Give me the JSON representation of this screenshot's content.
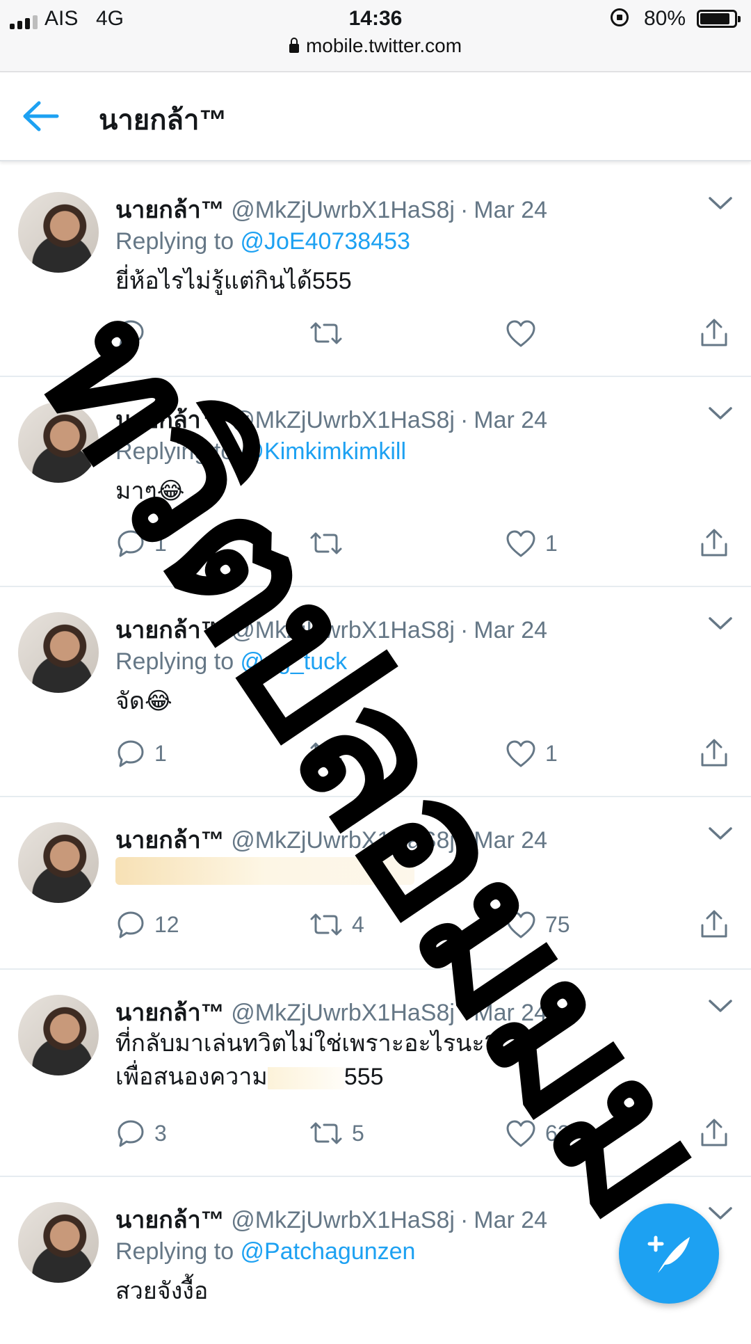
{
  "status_bar": {
    "carrier": "AIS",
    "network": "4G",
    "time": "14:36",
    "battery": "80%",
    "url": "mobile.twitter.com"
  },
  "header": {
    "title": "นายกล้า™"
  },
  "tweets": [
    {
      "name": "นายกล้า™",
      "handle": "@MkZjUwrbX1HaS8j",
      "sep": "·",
      "date": "Mar 24",
      "reply_prefix": "Replying to ",
      "reply_to": "@JoE40738453",
      "text": "ยี่ห้อไรไม่รู้แต่กินได้555",
      "replies": "",
      "retweets": "",
      "likes": ""
    },
    {
      "name": "นายกล้า™",
      "handle": "@MkZjUwrbX1HaS8j",
      "sep": "·",
      "date": "Mar 24",
      "reply_prefix": "Replying to ",
      "reply_to": "@Kimkimkimkill",
      "text": "มาๆ😂",
      "replies": "1",
      "retweets": "",
      "likes": "1"
    },
    {
      "name": "นายกล้า™",
      "handle": "@MkZjUwrbX1HaS8j",
      "sep": "·",
      "date": "Mar 24",
      "reply_prefix": "Replying to ",
      "reply_to": "@pg_tuck",
      "text": "จัด😂",
      "replies": "1",
      "retweets": "",
      "likes": "1"
    },
    {
      "name": "นายกล้า™",
      "handle": "@MkZjUwrbX1HaS8j",
      "sep": "·",
      "date": "Mar 24",
      "text": "",
      "replies": "12",
      "retweets": "4",
      "likes": "75"
    },
    {
      "name": "นายกล้า™",
      "handle": "@MkZjUwrbX1HaS8j",
      "sep": "·",
      "date": "Mar 24",
      "text_line1": "ที่กลับมาเล่นทวิตไม่ใช่เพราะอะไรนะ?",
      "text_line2": "เพื่อสนองความ",
      "text_line2_end": "555",
      "replies": "3",
      "retweets": "5",
      "likes": "62"
    },
    {
      "name": "นายกล้า™",
      "handle": "@MkZjUwrbX1HaS8j",
      "sep": "·",
      "date": "Mar 24",
      "reply_prefix": "Replying to ",
      "reply_to": "@Patchagunzen",
      "text": "สวยจังงื้อ",
      "replies": "",
      "retweets": "",
      "likes": ""
    }
  ],
  "watermark": "ทวิตปลอมมม",
  "colors": {
    "twitter_blue": "#1da1f2",
    "secondary_text": "#657786",
    "divider": "#e6ecf0"
  }
}
